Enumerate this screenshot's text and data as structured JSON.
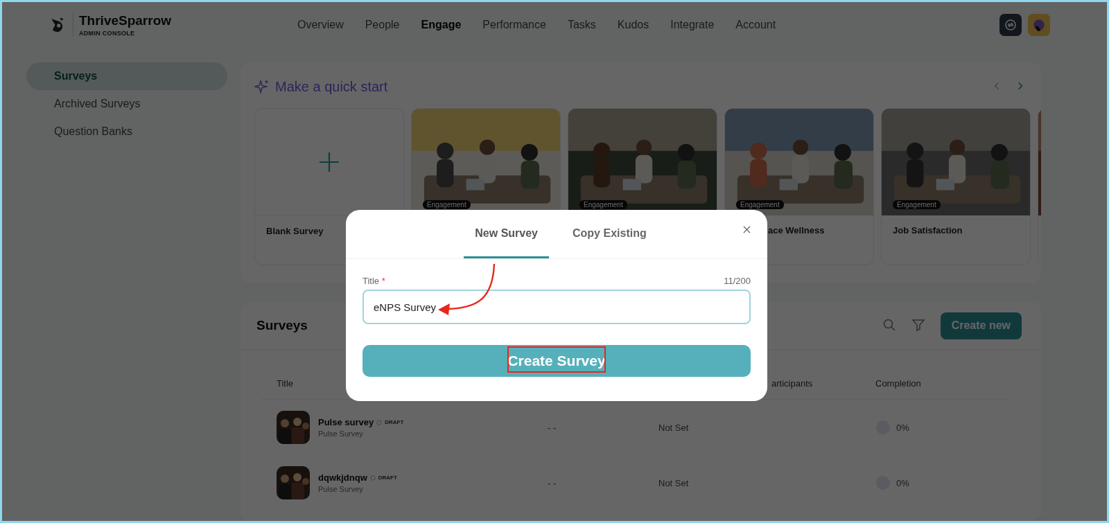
{
  "brand": {
    "name": "ThriveSparrow",
    "subtitle": "ADMIN CONSOLE"
  },
  "nav": [
    {
      "label": "Overview",
      "selected": false
    },
    {
      "label": "People",
      "selected": false
    },
    {
      "label": "Engage",
      "selected": true
    },
    {
      "label": "Performance",
      "selected": false
    },
    {
      "label": "Tasks",
      "selected": false
    },
    {
      "label": "Kudos",
      "selected": false
    },
    {
      "label": "Integrate",
      "selected": false
    },
    {
      "label": "Account",
      "selected": false
    }
  ],
  "sidebar": {
    "items": [
      {
        "label": "Surveys",
        "selected": true
      },
      {
        "label": "Archived Surveys",
        "selected": false
      },
      {
        "label": "Question Banks",
        "selected": false
      }
    ]
  },
  "quick_start": {
    "title": "Make a quick start",
    "cards": [
      {
        "kind": "blank",
        "title": "Blank Survey"
      },
      {
        "kind": "template",
        "tag": "Engagement"
      },
      {
        "kind": "template",
        "tag": "Engagement"
      },
      {
        "kind": "template",
        "tag": "Engagement",
        "title": "ace Wellness",
        "cut_off": true
      },
      {
        "kind": "template",
        "tag": "Engagement",
        "title": "Job Satisfaction"
      },
      {
        "kind": "template"
      }
    ]
  },
  "surveys": {
    "title": "Surveys",
    "create_button": "Create new",
    "columns": [
      {
        "label": "Title"
      },
      {
        "label": "articipants"
      },
      {
        "label": "Completion"
      }
    ],
    "rows": [
      {
        "title": "Pulse survey",
        "status": "DRAFT",
        "type": "Pulse Survey",
        "column_2": "- -",
        "column_3": "Not Set",
        "completion": "0%"
      },
      {
        "title": "dqwkjdnqw",
        "status": "DRAFT",
        "type": "Pulse Survey",
        "column_2": "- -",
        "column_3": "Not Set",
        "completion": "0%"
      }
    ]
  },
  "modal": {
    "tabs": [
      {
        "label": "New Survey",
        "selected": true
      },
      {
        "label": "Copy Existing",
        "selected": false
      }
    ],
    "field_label": "Title",
    "required_mark": "*",
    "counter": "11/200",
    "value": "eNPS Survey",
    "submit": "Create Survey"
  }
}
